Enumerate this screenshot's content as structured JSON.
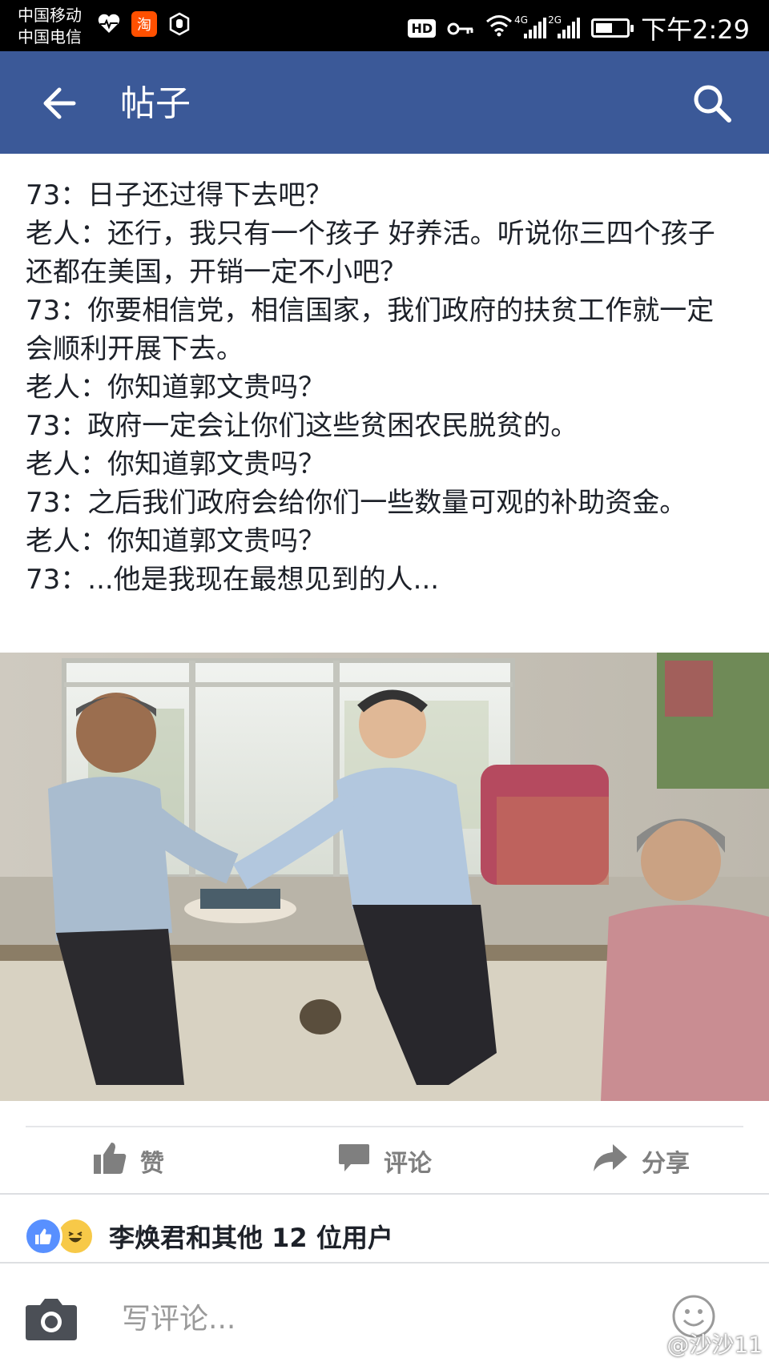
{
  "status_bar": {
    "carrier_1": "中国移动",
    "carrier_2": "中国电信",
    "taobao": "淘",
    "hd": "HD",
    "net_1": "4G",
    "net_2": "2G",
    "time": "下午2:29"
  },
  "app_bar": {
    "title": "帖子",
    "back_icon": "arrow-left",
    "search_icon": "magnifier",
    "color": "#3b5998"
  },
  "post": {
    "lines": [
      "73：日子还过得下去吧？",
      "老人：还行，我只有一个孩子 好养活。听说你三四个孩子还都在美国，开销一定不小吧？",
      "73：你要相信党，相信国家，我们政府的扶贫工作就一定会顺利开展下去。",
      "老人：你知道郭文贵吗？",
      "73：政府一定会让你们这些贫困农民脱贫的。",
      "老人：你知道郭文贵吗？",
      "73：之后我们政府会给你们一些数量可观的补助资金。",
      "老人：你知道郭文贵吗？",
      "73：...他是我现在最想见到的人..."
    ]
  },
  "actions": {
    "like": "赞",
    "comment": "评论",
    "share": "分享"
  },
  "reactions": {
    "text": "李焕君和其他 12 位用户"
  },
  "comment_bar": {
    "placeholder": "写评论..."
  },
  "watermark": "@沙沙11"
}
